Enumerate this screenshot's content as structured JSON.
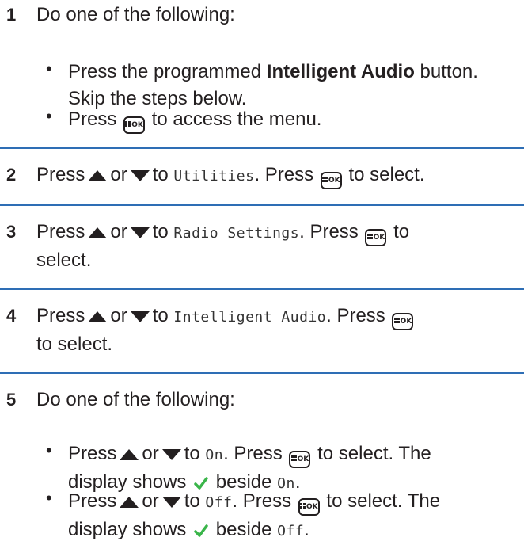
{
  "step1": {
    "number": "1",
    "intro": "Do one of the following:",
    "bullet1_pre": "Press the programmed ",
    "bullet1_bold": "Intelligent Audio",
    "bullet1_post": " button.",
    "bullet1_line2": "Skip the steps below.",
    "bullet2_pre": "Press ",
    "bullet2_post": " to access the menu."
  },
  "step2": {
    "number": "2",
    "press": "Press",
    "or": "or",
    "to": "to",
    "target": "Utilities",
    "after_target": ". Press ",
    "end": " to select."
  },
  "step3": {
    "number": "3",
    "press": "Press",
    "or": "or",
    "to": "to",
    "target": "Radio Settings",
    "after_target": ". Press ",
    "end": " to",
    "line2": "select."
  },
  "step4": {
    "number": "4",
    "press": "Press",
    "or": "or",
    "to": "to",
    "target": "Intelligent Audio",
    "after_target": ". Press ",
    "line2": "to select."
  },
  "step5": {
    "number": "5",
    "intro": "Do one of the following:",
    "b1_press": "Press",
    "b1_or": "or",
    "b1_to": "to",
    "b1_target": "On",
    "b1_after": ". Press ",
    "b1_end": " to select. The",
    "b1_line2_pre": "display shows ",
    "b1_line2_beside": " beside ",
    "b1_line2_target": "On",
    "b1_line2_end": ".",
    "b2_press": "Press",
    "b2_or": "or",
    "b2_to": "to",
    "b2_target": "Off",
    "b2_after": ". Press ",
    "b2_end": " to select. The",
    "b2_line2_pre": "display shows ",
    "b2_line2_beside": " beside ",
    "b2_line2_target": "Off",
    "b2_line2_end": "."
  },
  "ok_button": {
    "label": "OK",
    "icon": "menu-ok-icon"
  },
  "colors": {
    "separator": "#2e6eb5",
    "text": "#231f20",
    "check": "#3ab54a"
  }
}
